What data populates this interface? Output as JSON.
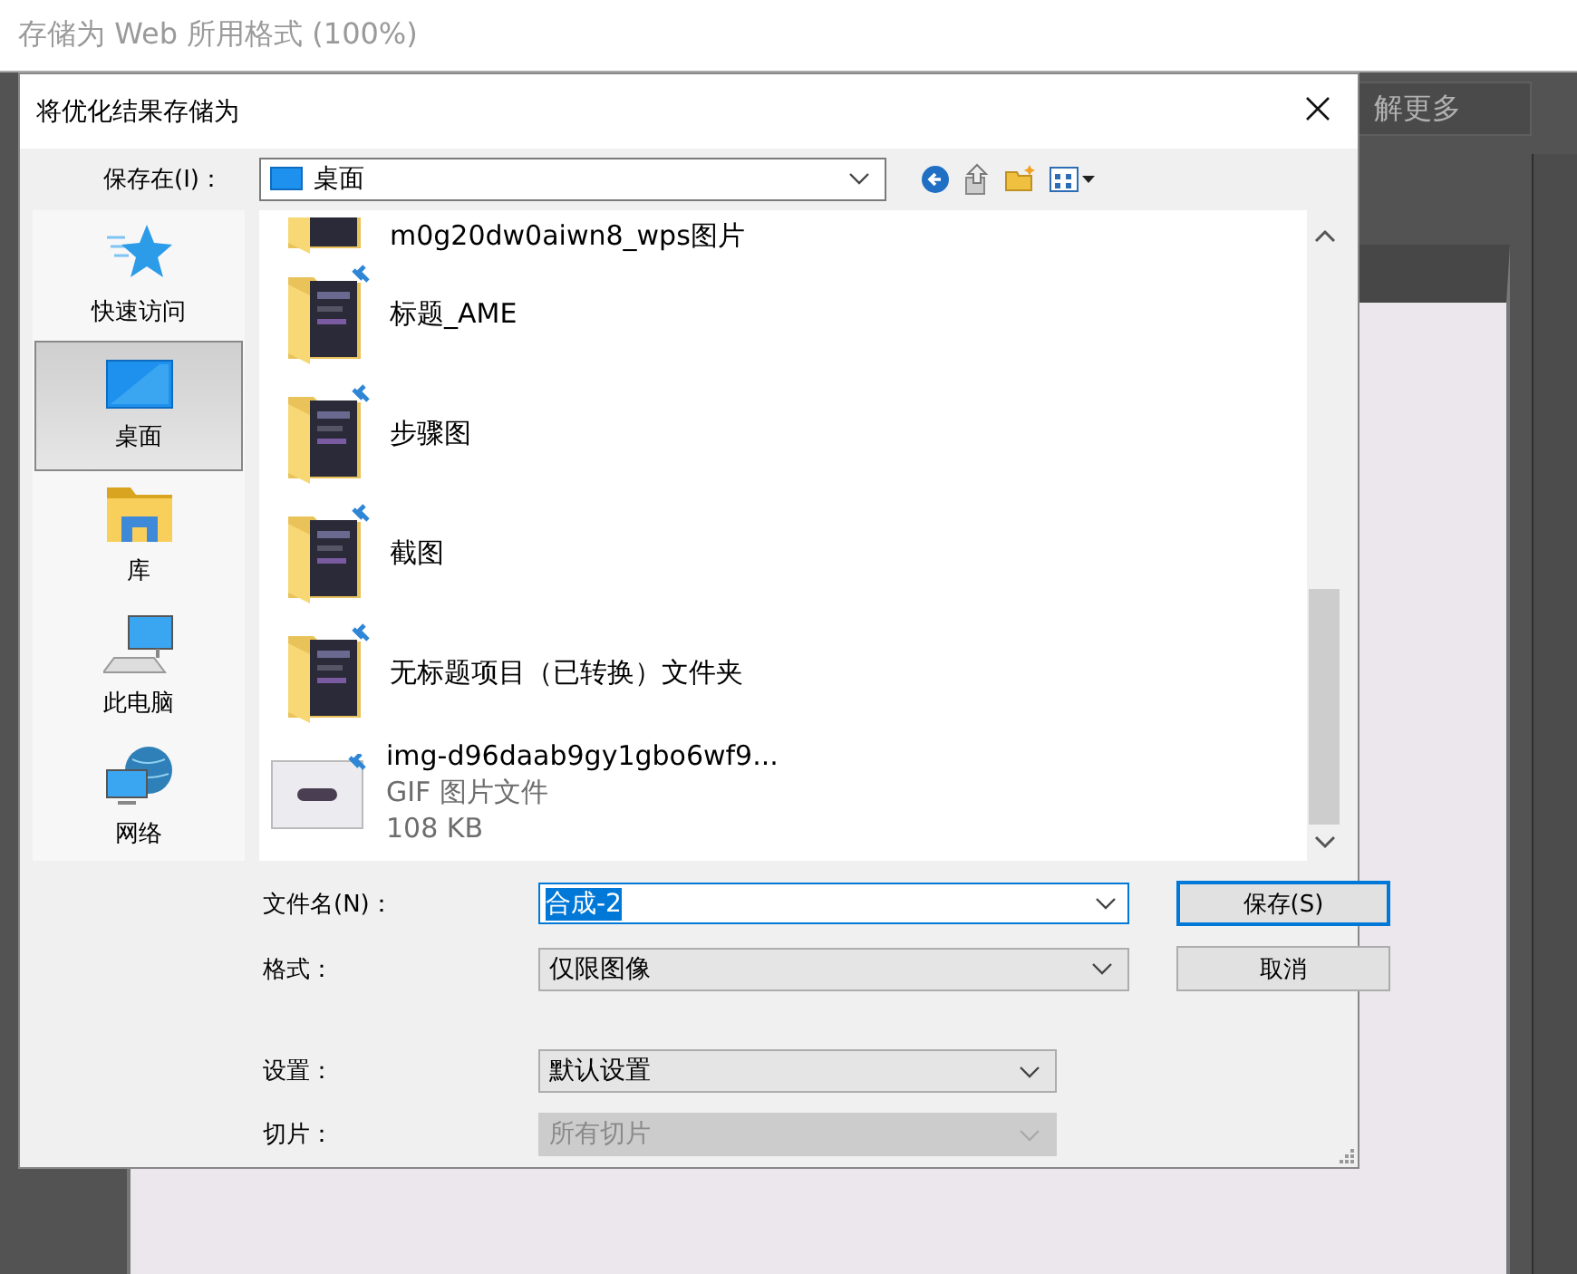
{
  "app_title": "存储为 Web 所用格式 (100%)",
  "background": {
    "learn_more_button": "解更多"
  },
  "dialog": {
    "title": "将优化结果存储为",
    "save_in": {
      "label": "保存在(I)：",
      "value": "桌面"
    },
    "places": [
      {
        "label": "快速访问",
        "kind": "star",
        "selected": false
      },
      {
        "label": "桌面",
        "kind": "desktop",
        "selected": true
      },
      {
        "label": "库",
        "kind": "library",
        "selected": false
      },
      {
        "label": "此电脑",
        "kind": "computer",
        "selected": false
      },
      {
        "label": "网络",
        "kind": "network",
        "selected": false
      }
    ],
    "files": [
      {
        "name": "m0g20dw0aiwn8_wps图片",
        "kind": "folder"
      },
      {
        "name": "标题_AME",
        "kind": "folder"
      },
      {
        "name": "步骤图",
        "kind": "folder"
      },
      {
        "name": "截图",
        "kind": "folder"
      },
      {
        "name": "无标题项目（已转换）文件夹",
        "kind": "folder"
      },
      {
        "name": "img-d96daab9gy1gbo6wf9...",
        "kind": "file",
        "type": "GIF 图片文件",
        "size": "108 KB"
      }
    ],
    "file_name": {
      "label": "文件名(N)：",
      "value": "合成-2"
    },
    "format": {
      "label": "格式：",
      "value": "仅限图像"
    },
    "settings": {
      "label": "设置：",
      "value": "默认设置",
      "disabled": false
    },
    "slices": {
      "label": "切片：",
      "value": "所有切片",
      "disabled": true
    },
    "buttons": [
      {
        "label": "保存(S)",
        "default": true
      },
      {
        "label": "取消",
        "default": false
      }
    ]
  }
}
